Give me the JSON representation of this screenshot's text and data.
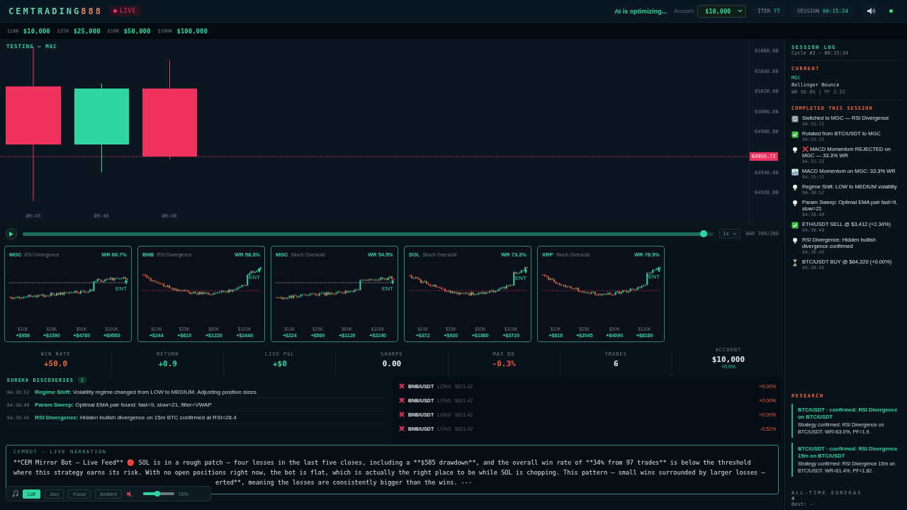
{
  "header": {
    "logo": {
      "text": "CEMTRADING",
      "accent": "888"
    },
    "live_badge": "LIVE",
    "status": "AI is optimizing...",
    "account_label": "Account:",
    "account_select": "$10,000",
    "iter": {
      "label": "ITER",
      "value": "77"
    },
    "session": {
      "label": "SESSION",
      "value": "00:15:24"
    }
  },
  "account_sizes": [
    {
      "short": "$10K",
      "amount": "$10,000"
    },
    {
      "short": "$25K",
      "amount": "$25,000"
    },
    {
      "short": "$50K",
      "amount": "$50,000"
    },
    {
      "short": "$100K",
      "amount": "$100,000"
    }
  ],
  "chart": {
    "title": "TESTING — MGC",
    "candles": [
      {
        "bullish": false
      },
      {
        "bullish": true
      },
      {
        "bullish": false
      }
    ],
    "time_labels": [
      "08:45",
      "08:46",
      "08:46"
    ],
    "price_labels": [
      "65060.00",
      "65040.00",
      "65020.00",
      "65000.00",
      "64980.00",
      "64940.00",
      "64920.00"
    ],
    "last_price": "64955.72"
  },
  "playback": {
    "level": 0.985,
    "speed": "1x",
    "bar": "BAR 200/200"
  },
  "strategy_cards": [
    {
      "symbol": "MGC",
      "strategy": "RSI Divergence",
      "win_rate": "WR 66.7%",
      "kind": "rising",
      "entry": "ENT",
      "returns": [
        {
          "size": "$10K",
          "pnl": "+$956"
        },
        {
          "size": "$25K",
          "pnl": "+$2390"
        },
        {
          "size": "$50K",
          "pnl": "+$4780"
        },
        {
          "size": "$100K",
          "pnl": "+$9560"
        }
      ]
    },
    {
      "symbol": "BNB",
      "strategy": "RSI Divergence",
      "win_rate": "WR 58.3%",
      "kind": "falling",
      "entry": "ENT",
      "returns": [
        {
          "size": "$10K",
          "pnl": "+$244"
        },
        {
          "size": "$25K",
          "pnl": "+$610"
        },
        {
          "size": "$50K",
          "pnl": "+$1220"
        },
        {
          "size": "$100K",
          "pnl": "+$2440"
        }
      ]
    },
    {
      "symbol": "MGC",
      "strategy": "Stoch Oversold",
      "win_rate": "WR 54.5%",
      "kind": "rising",
      "entry": "ENT",
      "returns": [
        {
          "size": "$10K",
          "pnl": "+$224"
        },
        {
          "size": "$25K",
          "pnl": "+$560"
        },
        {
          "size": "$50K",
          "pnl": "+$1120"
        },
        {
          "size": "$100K",
          "pnl": "+$2240"
        }
      ]
    },
    {
      "symbol": "SOL",
      "strategy": "Stoch Oversold",
      "win_rate": "WR 73.3%",
      "kind": "falling",
      "entry": "ENT",
      "returns": [
        {
          "size": "$10K",
          "pnl": "+$372"
        },
        {
          "size": "$25K",
          "pnl": "+$930"
        },
        {
          "size": "$50K",
          "pnl": "+$1860"
        },
        {
          "size": "$100K",
          "pnl": "+$3720"
        }
      ]
    },
    {
      "symbol": "XRP",
      "strategy": "Stoch Oversold",
      "win_rate": "WR 76.9%",
      "kind": "falling",
      "entry": "ENT",
      "returns": [
        {
          "size": "$10K",
          "pnl": "+$818"
        },
        {
          "size": "$25K",
          "pnl": "+$2045"
        },
        {
          "size": "$50K",
          "pnl": "+$4090"
        },
        {
          "size": "$100K",
          "pnl": "+$8180"
        }
      ]
    }
  ],
  "stats": [
    {
      "label": "WIN RATE",
      "value": "+50.0",
      "color": "#f06a3c"
    },
    {
      "label": "RETURN",
      "value": "+0.9",
      "color": "#2fd6a0"
    },
    {
      "label": "LIVE P&L",
      "value": "+$0",
      "color": "#2fd6a0"
    },
    {
      "label": "SHARPE",
      "value": "0.00",
      "color": "#e8eef0"
    },
    {
      "label": "MAX DD",
      "value": "-0.3%",
      "color": "#f0553c"
    },
    {
      "label": "TRADES",
      "value": "6",
      "color": "#e8eef0"
    },
    {
      "label": "ACCOUNT",
      "value": "$10,000",
      "change": "+0.0%",
      "color": "#e8eef0"
    }
  ],
  "eureka": {
    "title": "EUREKA DISCOVERIES",
    "count": "3",
    "items": [
      {
        "time": "04:30:52",
        "label": "Regime Shift:",
        "text": "Volatility regime changed from LOW to MEDIUM. Adjusting position sizes."
      },
      {
        "time": "04:30:49",
        "label": "Param Sweep:",
        "text": "Optimal EMA pair found: fast=9, slow=21, filter=VWAP"
      },
      {
        "time": "04:30:45",
        "label": "RSI Divergence:",
        "text": "Hidden bullish divergence on 15m BTC confirmed at RSI=28.4"
      }
    ]
  },
  "trades": [
    {
      "symbol": "BNB/USDT",
      "side": "LONG",
      "price": "$621.42",
      "pnl": "+0.00%",
      "won": false
    },
    {
      "symbol": "BNB/USDT",
      "side": "LONG",
      "price": "$621.42",
      "pnl": "+0.00%",
      "won": false
    },
    {
      "symbol": "BNB/USDT",
      "side": "LONG",
      "price": "$621.42",
      "pnl": "+0.00%",
      "won": false
    },
    {
      "symbol": "BNB/USDT",
      "side": "LONG",
      "price": "$621.42",
      "pnl": "-0.52%",
      "won": false
    }
  ],
  "narration": {
    "title": "CEMBOT — LIVE NARRATION",
    "lines": [
      "**CEM Mirror Bot — Live Feed** 🔴 SOL is in a rough patch — four losses in the last five closes, including a **$585 drawdown**, and the overall win rate of **34% from 97 trades** is below the threshold",
      "where this strategy earns its risk. With no open positions right now, the bot is flat, which is actually the right place to be while SOL is chopping. This pattern — small wins surrounded by larger losses —"
    ],
    "tail": "erted**, meaning the losses are consistently bigger than the wins. ---"
  },
  "music": {
    "genres": [
      {
        "label": "Loft",
        "selected": true
      },
      {
        "label": "Jazz",
        "selected": false
      },
      {
        "label": "Focus",
        "selected": false
      },
      {
        "label": "Ambient",
        "selected": false
      }
    ],
    "volume": {
      "level": 0.45,
      "reading": "18%"
    }
  },
  "session_log": {
    "title": "SESSION LOG",
    "cycle": "Cycle #2 — 00:15:24",
    "current_label": "CURRENT",
    "current": {
      "symbol": "MGC",
      "strategy": "Bollinger Bounce",
      "stats": "WR 50.0% | PF 2.22"
    },
    "completed_label": "COMPLETED THIS SESSION",
    "events": [
      {
        "kind": "switch",
        "text": "Switched to MGC — RSI Divergence",
        "time": "04:35:31"
      },
      {
        "kind": "check",
        "text": "Rotated from BTC/USDT to MGC",
        "time": "04:35:31"
      },
      {
        "kind": "idea",
        "text": "❌ MACD Momentum REJECTED on MGC — 33.3% WR",
        "time": "04:35:31"
      },
      {
        "kind": "chart",
        "text": "MACD Momentum on MGC: 33.3% WR",
        "time": "04:35:31"
      },
      {
        "kind": "idea",
        "text": "Regime Shift: LOW to MEDIUM volatility",
        "time": "04:30:52"
      },
      {
        "kind": "idea",
        "text": "Param Sweep: Optimal EMA pair fast=9, slow=21",
        "time": "04:30:49"
      },
      {
        "kind": "check",
        "text": "ETH/USDT SELL @ $3,412 (+2.34%)",
        "time": "04:30:49"
      },
      {
        "kind": "idea",
        "text": "RSI Divergence: Hidden bullish divergence confirmed",
        "time": "04:30:45"
      },
      {
        "kind": "pending",
        "text": "BTC/USDT BUY @ $64,320 (+0.00%)",
        "time": "04:30:45"
      }
    ]
  },
  "research": {
    "title": "RESEARCH",
    "items": [
      {
        "title": "BTC/USDT · confirmed: RSI Divergence on BTC/USDT",
        "body": "Strategy confirmed: RSI Divergence on BTC/USDT. WR=63.0%, PF=1.9."
      },
      {
        "title": "BTC/USDT · confirmed: RSI Divergence 15m on BTC/USDT",
        "body": "Strategy confirmed: RSI Divergence 15m on BTC/USDT. WR=61.4%, PF=1.82."
      }
    ]
  },
  "all_time": {
    "label": "ALL-TIME EUREKAS",
    "count": "4",
    "best": "Best: --"
  }
}
